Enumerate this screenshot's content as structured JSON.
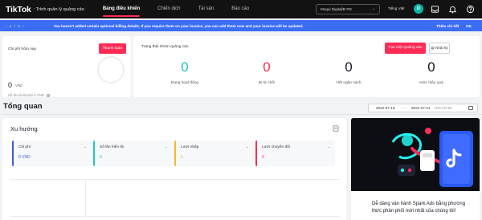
{
  "nav": {
    "logo": "TikTok",
    "logo_sub": ": Trình quản lý quảng cáo",
    "items": [
      {
        "label": "Bảng điều khiển"
      },
      {
        "label": "Chiến dịch"
      },
      {
        "label": "Tài sản"
      },
      {
        "label": "Báo cáo"
      }
    ],
    "account": "Moqui Digital/Ð PD",
    "language": "Tiếng Việt",
    "avatar_letter": "D"
  },
  "banner": {
    "pager": "‹ 1 / 2 ›",
    "message": "You haven't added certain optional billing details. If you require them on your invoice, you can add them now and your invoice will be updated.",
    "detail_link": "Thêm chi tiết",
    "ok_label": "OK"
  },
  "spend": {
    "title": "Chi phí hôm nay",
    "topup_label": "Thanh toán",
    "value": "0",
    "unit": "VND",
    "balance": "Số dư tài khoản 0 VND"
  },
  "campaign_status": {
    "title": "Trạng thái nhóm quảng cáo",
    "create_label": "Tạo một Quảng cáo",
    "log_label": "Nhật ký",
    "metrics": [
      {
        "value": "0",
        "label": "Đang hoạt động",
        "color": "#20c7b5"
      },
      {
        "value": "0",
        "label": "Bị từ chối",
        "color": "#fe2c55"
      },
      {
        "value": "0",
        "label": "Hết ngân sách",
        "color": "#161823"
      },
      {
        "value": "0",
        "label": "Kém hiệu quả",
        "color": "#161823"
      }
    ]
  },
  "overview": {
    "title": "Tổng quan",
    "date_start": "2022-07-15",
    "date_end": "2022-07-21",
    "timezone": "UTC+07:00"
  },
  "trend": {
    "title": "Xu hướng",
    "tiles": [
      {
        "label": "Chi phí",
        "value": "0 VND",
        "accent": "#3a5bd9",
        "value_color": "#3a5bd9"
      },
      {
        "label": "Số lần hiển thị",
        "value": "0",
        "accent": "#20c7b5",
        "value_color": "#20c7b5"
      },
      {
        "label": "Lượt nhấp",
        "value": "0",
        "accent": "#f7b733",
        "value_color": "#f7b733"
      },
      {
        "label": "Lượt chuyển đổi",
        "value": "0",
        "accent": "#fe2c55",
        "value_color": "#fe2c55"
      }
    ]
  },
  "promo": {
    "text": "Dễ dàng vận hành Spark Ads bằng phương thức phân phối mới nhất của chúng tôi!"
  }
}
